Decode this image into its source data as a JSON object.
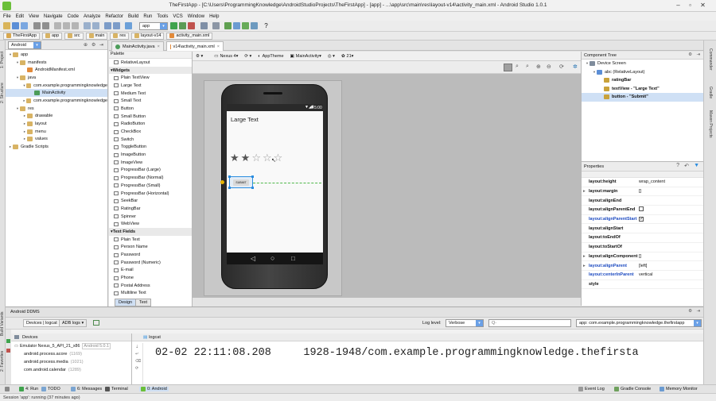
{
  "window": {
    "title": "TheFirstApp - [C:\\Users\\ProgrammingKnowledge\\AndroidStudioProjects\\TheFirstApp] - [app] - ...\\app\\src\\main\\res\\layout-v14\\activity_main.xml - Android Studio 1.0.1"
  },
  "menu": [
    "File",
    "Edit",
    "View",
    "Navigate",
    "Code",
    "Analyze",
    "Refactor",
    "Build",
    "Run",
    "Tools",
    "VCS",
    "Window",
    "Help"
  ],
  "breadcrumbs": [
    "TheFirstApp",
    "app",
    "src",
    "main",
    "res",
    "layout-v14",
    "activity_main.xml"
  ],
  "toolbar": {
    "run_config": "app"
  },
  "left_strip": {
    "project": "1: Project",
    "structure": "2: Structure",
    "build_variants": "Build Variants",
    "favorites": "2: Favorites"
  },
  "right_strip": {
    "commander": "Commander",
    "gradle": "Gradle",
    "maven": "Maven Projects"
  },
  "project": {
    "view_selector": "Android",
    "tree": [
      {
        "label": "app",
        "level": 0,
        "arrow": "▾"
      },
      {
        "label": "manifests",
        "level": 1,
        "arrow": "▾"
      },
      {
        "label": "AndroidManifest.xml",
        "level": 2,
        "arrow": ""
      },
      {
        "label": "java",
        "level": 1,
        "arrow": "▾"
      },
      {
        "label": "com.example.programmingknowledge",
        "level": 2,
        "arrow": "▾"
      },
      {
        "label": "MainActivity",
        "level": 3,
        "arrow": "",
        "selected": true
      },
      {
        "label": "com.example.programmingknowledge",
        "level": 2,
        "arrow": "▸"
      },
      {
        "label": "res",
        "level": 1,
        "arrow": "▾"
      },
      {
        "label": "drawable",
        "level": 2,
        "arrow": "▸"
      },
      {
        "label": "layout",
        "level": 2,
        "arrow": "▸"
      },
      {
        "label": "menu",
        "level": 2,
        "arrow": "▸"
      },
      {
        "label": "values",
        "level": 2,
        "arrow": "▸"
      },
      {
        "label": "Gradle Scripts",
        "level": 0,
        "arrow": "▸"
      }
    ]
  },
  "file_tabs": [
    "MainActivity.java",
    "v14\\activity_main.xml"
  ],
  "palette": {
    "title": "Palette",
    "items": [
      {
        "label": "RelativeLayout",
        "group": false
      },
      {
        "label": "Widgets",
        "group": true
      },
      {
        "label": "Plain TextView",
        "group": false
      },
      {
        "label": "Large Text",
        "group": false
      },
      {
        "label": "Medium Text",
        "group": false
      },
      {
        "label": "Small Text",
        "group": false
      },
      {
        "label": "Button",
        "group": false
      },
      {
        "label": "Small Button",
        "group": false
      },
      {
        "label": "RadioButton",
        "group": false
      },
      {
        "label": "CheckBox",
        "group": false
      },
      {
        "label": "Switch",
        "group": false
      },
      {
        "label": "ToggleButton",
        "group": false
      },
      {
        "label": "ImageButton",
        "group": false
      },
      {
        "label": "ImageView",
        "group": false
      },
      {
        "label": "ProgressBar (Large)",
        "group": false
      },
      {
        "label": "ProgressBar (Normal)",
        "group": false
      },
      {
        "label": "ProgressBar (Small)",
        "group": false
      },
      {
        "label": "ProgressBar (Horizontal)",
        "group": false
      },
      {
        "label": "SeekBar",
        "group": false
      },
      {
        "label": "RatingBar",
        "group": false
      },
      {
        "label": "Spinner",
        "group": false
      },
      {
        "label": "WebView",
        "group": false
      },
      {
        "label": "Text Fields",
        "group": true
      },
      {
        "label": "Plain Text",
        "group": false
      },
      {
        "label": "Person Name",
        "group": false
      },
      {
        "label": "Password",
        "group": false
      },
      {
        "label": "Password (Numeric)",
        "group": false
      },
      {
        "label": "E-mail",
        "group": false
      },
      {
        "label": "Phone",
        "group": false
      },
      {
        "label": "Postal Address",
        "group": false
      },
      {
        "label": "Multiline Text",
        "group": false
      }
    ]
  },
  "design_toolbar": {
    "device": "Nexus 4",
    "theme": "AppTheme",
    "activity": "MainActivity",
    "api": "21"
  },
  "phone": {
    "time": "5:00",
    "large_text": "Large Text",
    "button_text": "SUBMIT",
    "rating_stars": 5,
    "rating_filled": 2
  },
  "design_tabs": [
    "Design",
    "Text"
  ],
  "component_tree": {
    "title": "Component Tree",
    "items": [
      {
        "label": "Device Screen",
        "level": 0
      },
      {
        "label": "abc (RelativeLayout)",
        "level": 1
      },
      {
        "label": "ratingBar",
        "level": 2
      },
      {
        "label": "textView - \"Large Text\"",
        "level": 2
      },
      {
        "label": "button - \"Submit\"",
        "level": 2,
        "selected": true
      }
    ]
  },
  "properties": {
    "title": "Properties",
    "rows": [
      {
        "name": "layout:height",
        "value": "wrap_content",
        "blue": false
      },
      {
        "name": "layout:margin",
        "value": "[]",
        "blue": false,
        "arrow": "▸"
      },
      {
        "name": "layout:alignEnd",
        "value": "",
        "blue": false
      },
      {
        "name": "layout:alignParentEnd",
        "value": "",
        "blue": false,
        "check": "off"
      },
      {
        "name": "layout:alignParentStart",
        "value": "",
        "blue": true,
        "check": "on"
      },
      {
        "name": "layout:alignStart",
        "value": "",
        "blue": false
      },
      {
        "name": "layout:toEndOf",
        "value": "",
        "blue": false
      },
      {
        "name": "layout:toStartOf",
        "value": "",
        "blue": false
      },
      {
        "name": "layout:alignComponent",
        "value": "[]",
        "blue": false,
        "arrow": "▸"
      },
      {
        "name": "layout:alignParent",
        "value": "[left]",
        "blue": true,
        "arrow": "▸"
      },
      {
        "name": "layout:centerInParent",
        "value": "vertical",
        "blue": true
      },
      {
        "name": "style",
        "value": "",
        "blue": false
      }
    ]
  },
  "ddms": {
    "title": "Android DDMS",
    "tabs": [
      "Devices | logcat",
      "ADB logs"
    ],
    "log_level_label": "Log level:",
    "log_level": "Verbose",
    "filter_placeholder": "Q-",
    "app_filter": "app: com.example.programmingknowledge.thefirstapp",
    "devices_label": "Devices",
    "emulator": "Emulator Nexus_5_API_21_x86",
    "emulator_version": "Android 5.0.1",
    "processes": [
      {
        "name": "android.process.acore",
        "pid": "(1169)"
      },
      {
        "name": "android.process.media",
        "pid": "(1021)"
      },
      {
        "name": "com.android.calendar",
        "pid": "(1289)"
      }
    ],
    "logcat_label": "logcat",
    "log_time": "02-02 22:11:08.208",
    "log_text": "1928-1948/com.example.programmingknowledge.thefirsta"
  },
  "bottom_tabs": [
    "4: Run",
    "TODO",
    "6: Messages",
    "Terminal",
    "0: Android"
  ],
  "bottom_right_tabs": [
    "Event Log",
    "Gradle Console",
    "Memory Monitor"
  ],
  "status": "Session 'app': running (37 minutes ago)"
}
